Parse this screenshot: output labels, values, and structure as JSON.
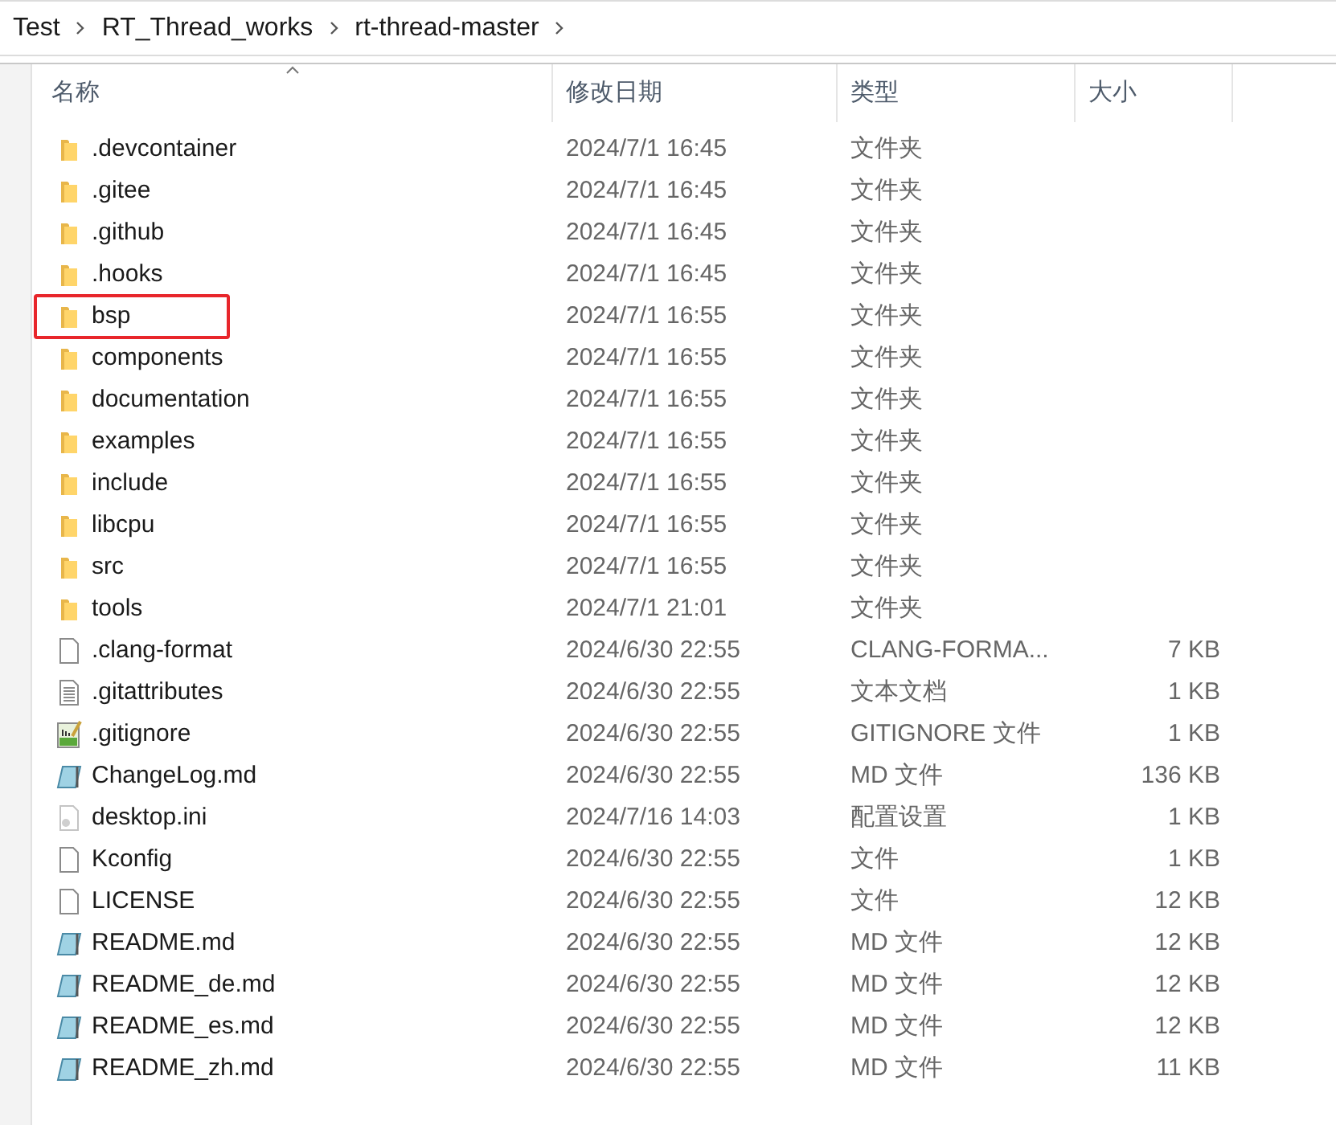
{
  "breadcrumb": [
    "Test",
    "RT_Thread_works",
    "rt-thread-master"
  ],
  "columns": [
    {
      "label": "名称",
      "sorted": true
    },
    {
      "label": "修改日期",
      "sorted": false
    },
    {
      "label": "类型",
      "sorted": false
    },
    {
      "label": "大小",
      "sorted": false
    }
  ],
  "rows": [
    {
      "kind": "folder",
      "name": ".devcontainer",
      "date": "2024/7/1 16:45",
      "type": "文件夹",
      "highlighted": false
    },
    {
      "kind": "folder",
      "name": ".gitee",
      "date": "2024/7/1 16:45",
      "type": "文件夹",
      "highlighted": false
    },
    {
      "kind": "folder",
      "name": ".github",
      "date": "2024/7/1 16:45",
      "type": "文件夹",
      "highlighted": false
    },
    {
      "kind": "folder",
      "name": ".hooks",
      "date": "2024/7/1 16:45",
      "type": "文件夹",
      "highlighted": false
    },
    {
      "kind": "folder",
      "name": "bsp",
      "date": "2024/7/1 16:55",
      "type": "文件夹",
      "highlighted": true
    },
    {
      "kind": "folder",
      "name": "components",
      "date": "2024/7/1 16:55",
      "type": "文件夹",
      "highlighted": false
    },
    {
      "kind": "folder",
      "name": "documentation",
      "date": "2024/7/1 16:55",
      "type": "文件夹",
      "highlighted": false
    },
    {
      "kind": "folder",
      "name": "examples",
      "date": "2024/7/1 16:55",
      "type": "文件夹",
      "highlighted": false
    },
    {
      "kind": "folder",
      "name": "include",
      "date": "2024/7/1 16:55",
      "type": "文件夹",
      "highlighted": false
    },
    {
      "kind": "folder",
      "name": "libcpu",
      "date": "2024/7/1 16:55",
      "type": "文件夹",
      "highlighted": false
    },
    {
      "kind": "folder",
      "name": "src",
      "date": "2024/7/1 16:55",
      "type": "文件夹",
      "highlighted": false
    },
    {
      "kind": "folder",
      "name": "tools",
      "date": "2024/7/1 21:01",
      "type": "文件夹",
      "highlighted": false
    },
    {
      "kind": "blank",
      "name": ".clang-format",
      "date": "2024/6/30 22:55",
      "type": "CLANG-FORMA...",
      "size": "7 KB",
      "highlighted": false
    },
    {
      "kind": "text",
      "name": ".gitattributes",
      "date": "2024/6/30 22:55",
      "type": "文本文档",
      "size": "1 KB",
      "highlighted": false
    },
    {
      "kind": "chart",
      "name": ".gitignore",
      "date": "2024/6/30 22:55",
      "type": "GITIGNORE 文件",
      "size": "1 KB",
      "highlighted": false
    },
    {
      "kind": "markdown",
      "name": "ChangeLog.md",
      "date": "2024/6/30 22:55",
      "type": "MD 文件",
      "size": "136 KB",
      "highlighted": false
    },
    {
      "kind": "settings",
      "name": "desktop.ini",
      "date": "2024/7/16 14:03",
      "type": "配置设置",
      "size": "1 KB",
      "highlighted": false
    },
    {
      "kind": "blank",
      "name": "Kconfig",
      "date": "2024/6/30 22:55",
      "type": "文件",
      "size": "1 KB",
      "highlighted": false
    },
    {
      "kind": "blank",
      "name": "LICENSE",
      "date": "2024/6/30 22:55",
      "type": "文件",
      "size": "12 KB",
      "highlighted": false
    },
    {
      "kind": "markdown",
      "name": "README.md",
      "date": "2024/6/30 22:55",
      "type": "MD 文件",
      "size": "12 KB",
      "highlighted": false
    },
    {
      "kind": "markdown",
      "name": "README_de.md",
      "date": "2024/6/30 22:55",
      "type": "MD 文件",
      "size": "12 KB",
      "highlighted": false
    },
    {
      "kind": "markdown",
      "name": "README_es.md",
      "date": "2024/6/30 22:55",
      "type": "MD 文件",
      "size": "12 KB",
      "highlighted": false
    },
    {
      "kind": "markdown",
      "name": "README_zh.md",
      "date": "2024/6/30 22:55",
      "type": "MD 文件",
      "size": "11 KB",
      "highlighted": false
    }
  ]
}
